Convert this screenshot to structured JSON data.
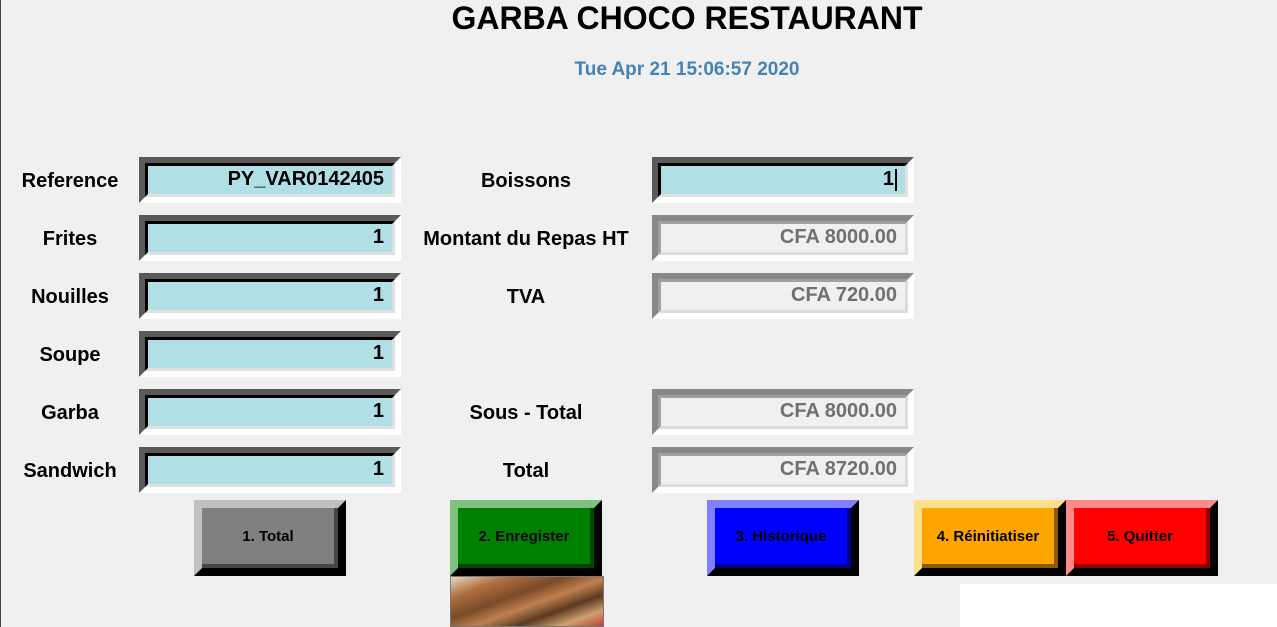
{
  "header": {
    "title": "GARBA CHOCO RESTAURANT",
    "datetime": "Tue Apr 21 15:06:57 2020"
  },
  "left": {
    "reference": {
      "label": "Reference",
      "value": "PY_VAR0142405"
    },
    "frites": {
      "label": "Frites",
      "value": "1"
    },
    "nouilles": {
      "label": "Nouilles",
      "value": "1"
    },
    "soupe": {
      "label": "Soupe",
      "value": "1"
    },
    "garba": {
      "label": "Garba",
      "value": "1"
    },
    "sandwich": {
      "label": "Sandwich",
      "value": "1"
    }
  },
  "right": {
    "boissons": {
      "label": "Boissons",
      "value": "1"
    },
    "montant": {
      "label": "Montant du Repas HT",
      "value": "CFA 8000.00"
    },
    "tva": {
      "label": "TVA",
      "value": "CFA 720.00"
    },
    "sous_total": {
      "label": "Sous - Total",
      "value": "CFA 8000.00"
    },
    "total": {
      "label": "Total",
      "value": "CFA 8720.00"
    }
  },
  "buttons": {
    "total": {
      "label": "1. Total",
      "color": "#808080"
    },
    "enregister": {
      "label": "2. Enregister",
      "color": "#008000"
    },
    "historique": {
      "label": "3. Historique",
      "color": "#0000ff"
    },
    "reinitiatiser": {
      "label": "4. Réinitiatiser",
      "color": "#ffa500"
    },
    "quitter": {
      "label": "5. Quitter",
      "color": "#ff0000"
    }
  }
}
